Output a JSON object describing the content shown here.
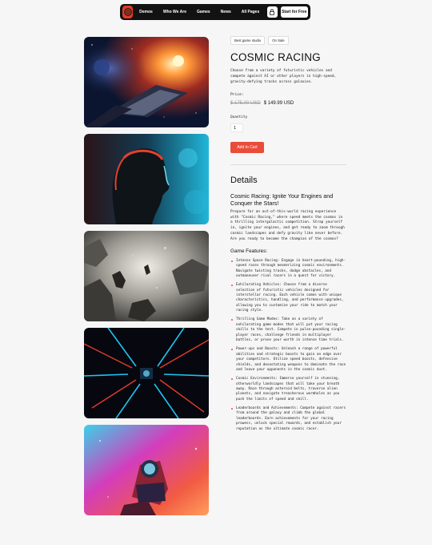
{
  "nav": {
    "links": [
      "Demos",
      "Who We Are",
      "Games",
      "News",
      "All Pages"
    ],
    "cta_label": "Start for Free",
    "logo_icon": "spiral-logo-icon",
    "cart_icon": "lock-bag-icon"
  },
  "product": {
    "tags": [
      "Best game studio",
      "On Sale"
    ],
    "title": "COSMIC RACING",
    "description": "Choose from a variety of futuristic vehicles and compete against AI or other players in high-speed, gravity-defying tracks across galaxies.",
    "price_label": "Price:",
    "old_price": "$ 175.00 USD",
    "new_price": "$ 149.99 USD",
    "quantity_label": "Quantity",
    "quantity_value": "1",
    "add_to_cart_label": "Add to Cart"
  },
  "details": {
    "heading": "Details",
    "subheading": "Cosmic Racing: Ignite Your Engines and Conquer the Stars!",
    "intro": "Prepare for an out-of-this-world racing experience with \"Cosmic Racing,\" where speed meets the cosmos in a thrilling intergalactic competition. Strap yourself in, ignite your engines, and get ready to zoom through cosmic landscapes and defy gravity like never before. Are you ready to become the champion of the cosmos?",
    "features_heading": "Game Features:",
    "features": [
      "Intense Space Racing: Engage in heart-pounding, high-speed races through mesmerizing cosmic environments. Navigate twisting tracks, dodge obstacles, and outmaneuver rival racers in a quest for victory.",
      "Exhilarating Vehicles: Choose from a diverse selection of futuristic vehicles designed for interstellar racing. Each vehicle comes with unique characteristics, handling, and performance upgrades, allowing you to customize your ride to match your racing style.",
      "Thrilling Game Modes: Take on a variety of exhilarating game modes that will put your racing skills to the test. Compete in pulse-pounding single-player races, challenge friends in multiplayer battles, or prove your worth in intense time trials.",
      "Power-ups and Boosts: Unleash a range of powerful abilities and strategic boosts to gain an edge over your competitors. Utilize speed boosts, defensive shields, and devastating weapons to dominate the race and leave your opponents in the cosmic dust.",
      "Cosmic Environments: Immerse yourself in stunning, otherworldly landscapes that will take your breath away. Race through asteroid belts, traverse alien planets, and navigate treacherous wormholes as you push the limits of speed and skill.",
      "Leaderboards and Achievements: Compete against racers from around the galaxy and climb the global leaderboards. Earn achievements for your racing prowess, unlock special rewards, and establish your reputation as the ultimate cosmic racer."
    ]
  },
  "colors": {
    "accent": "#ea4c3a",
    "nav_bg": "#121212",
    "page_bg": "#f6f6f6"
  }
}
